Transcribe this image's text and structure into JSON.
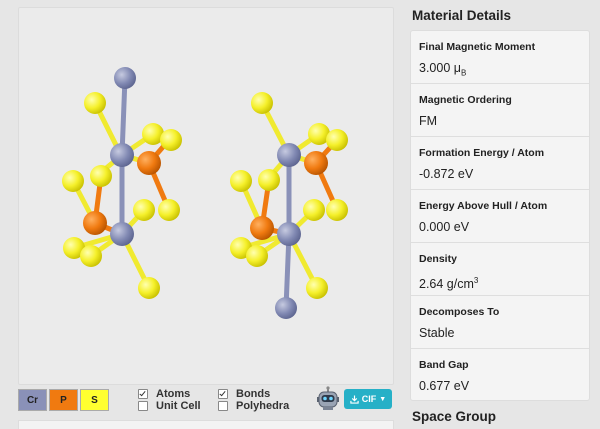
{
  "legend": [
    {
      "symbol": "Cr",
      "color": "#8a91b8"
    },
    {
      "symbol": "P",
      "color": "#f07a10"
    },
    {
      "symbol": "S",
      "color": "#ffff30"
    }
  ],
  "options": {
    "atoms": "Atoms",
    "unit_cell": "Unit Cell",
    "bonds": "Bonds",
    "polyhedra": "Polyhedra"
  },
  "download_label": "CIF",
  "panel_title": "Material Details",
  "details": [
    {
      "label": "Final Magnetic Moment",
      "value": "3.000 μ",
      "sub": "B"
    },
    {
      "label": "Magnetic Ordering",
      "value": "FM"
    },
    {
      "label": "Formation Energy / Atom",
      "value": "-0.872 eV"
    },
    {
      "label": "Energy Above Hull / Atom",
      "value": "0.000 eV"
    },
    {
      "label": "Density",
      "value": "2.64 g/cm",
      "sup": "3"
    },
    {
      "label": "Decomposes To",
      "value": "Stable"
    },
    {
      "label": "Band Gap",
      "value": "0.677 eV"
    }
  ],
  "section2_title": "Space Group",
  "colors": {
    "cr": "#8a91b8",
    "p": "#f07a10",
    "s": "#ffff30",
    "accent": "#26b0c7"
  }
}
